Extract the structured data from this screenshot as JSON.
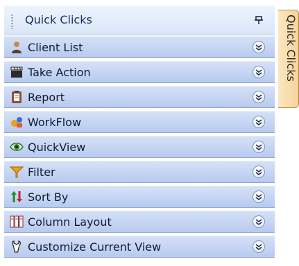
{
  "panel": {
    "title": "Quick Clicks",
    "pin_icon": "pin-icon",
    "items": [
      {
        "label": "Client List",
        "icon": "person-icon"
      },
      {
        "label": "Take Action",
        "icon": "clapperboard-icon"
      },
      {
        "label": "Report",
        "icon": "clipboard-icon"
      },
      {
        "label": "WorkFlow",
        "icon": "workflow-icon"
      },
      {
        "label": "QuickView",
        "icon": "eye-icon"
      },
      {
        "label": "Filter",
        "icon": "funnel-icon"
      },
      {
        "label": "Sort By",
        "icon": "sort-arrows-icon"
      },
      {
        "label": "Column Layout",
        "icon": "columns-icon"
      },
      {
        "label": "Customize Current View",
        "icon": "wrench-icon"
      }
    ]
  },
  "side_tab": {
    "label": "Quick Clicks"
  },
  "colors": {
    "accent": "#b7caef",
    "tab": "#f6d49b"
  }
}
